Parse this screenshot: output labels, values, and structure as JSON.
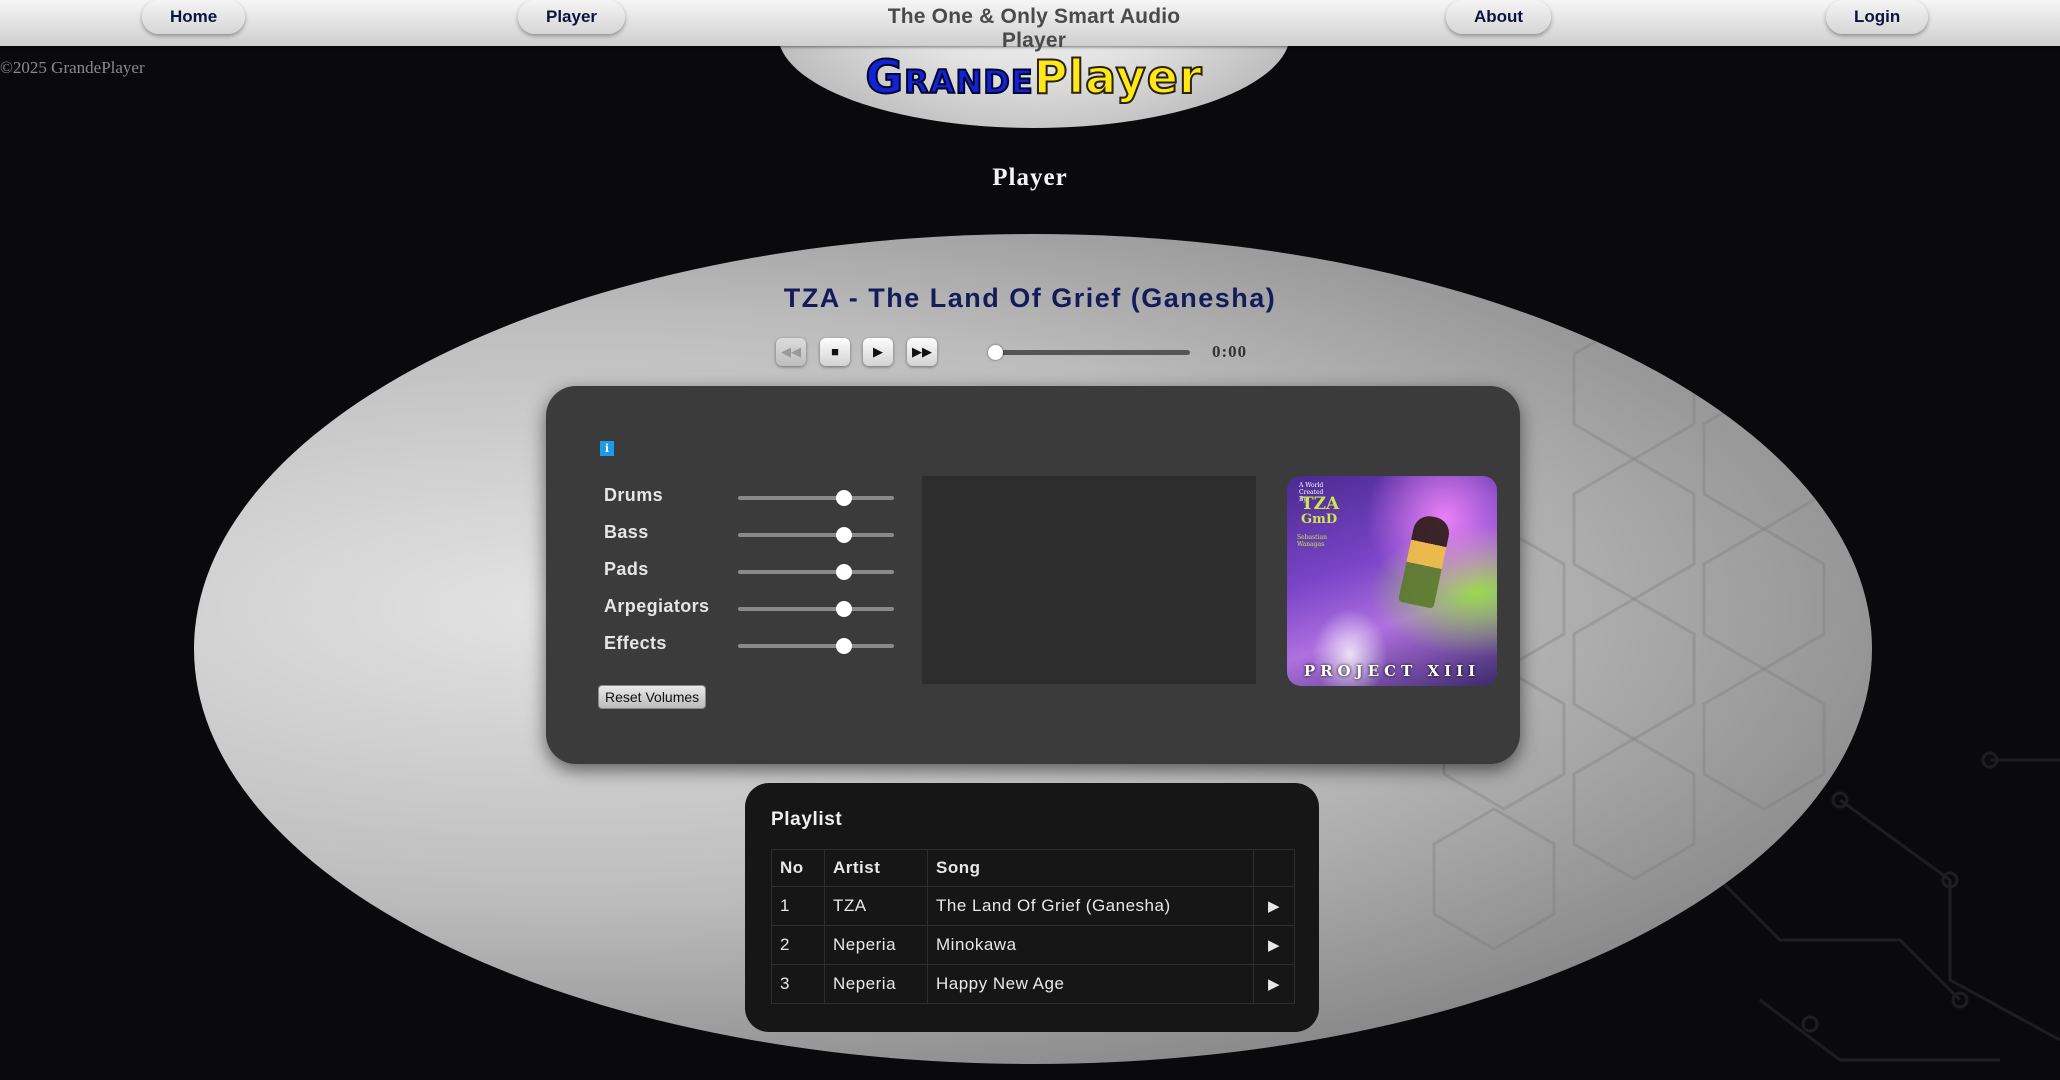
{
  "nav": {
    "home": "Home",
    "player": "Player",
    "tagline": "The One & Only Smart Audio Player",
    "about": "About",
    "login": "Login"
  },
  "logo": {
    "word1": "Grande",
    "word2": "Player"
  },
  "copyright": "©2025 GrandePlayer",
  "page_heading": "Player",
  "now_playing": {
    "title": "TZA - The Land Of Grief (Ganesha)",
    "time": "0:00",
    "progress": 0
  },
  "transport": {
    "rewind_icon": "rewind-icon",
    "stop_icon": "stop-icon",
    "play_icon": "play-icon",
    "forward_icon": "fast-forward-icon"
  },
  "mixer": {
    "info_icon": "info-icon",
    "info_glyph": "i",
    "channels": [
      {
        "label": "Drums",
        "level": 0.68
      },
      {
        "label": "Bass",
        "level": 0.68
      },
      {
        "label": "Pads",
        "level": 0.68
      },
      {
        "label": "Arpegiators",
        "level": 0.68
      },
      {
        "label": "Effects",
        "level": 0.68
      }
    ],
    "reset_label": "Reset Volumes"
  },
  "album": {
    "line1": "A World Created By",
    "artist": "TZA",
    "logo_text": "GmD",
    "line3": "Sebastian Wanagas",
    "name": "PROJECT XIII"
  },
  "playlist": {
    "title": "Playlist",
    "columns": [
      "No",
      "Artist",
      "Song",
      ""
    ],
    "rows": [
      {
        "no": "1",
        "artist": "TZA",
        "song": "The Land Of Grief (Ganesha)"
      },
      {
        "no": "2",
        "artist": "Neperia",
        "song": "Minokawa"
      },
      {
        "no": "3",
        "artist": "Neperia",
        "song": "Happy New Age"
      }
    ],
    "play_glyph": "▶"
  },
  "colors": {
    "accent_title": "#141a5a",
    "logo_blue": "#1223d6",
    "logo_yellow": "#ffe81a",
    "info_blue": "#1e9be8"
  }
}
